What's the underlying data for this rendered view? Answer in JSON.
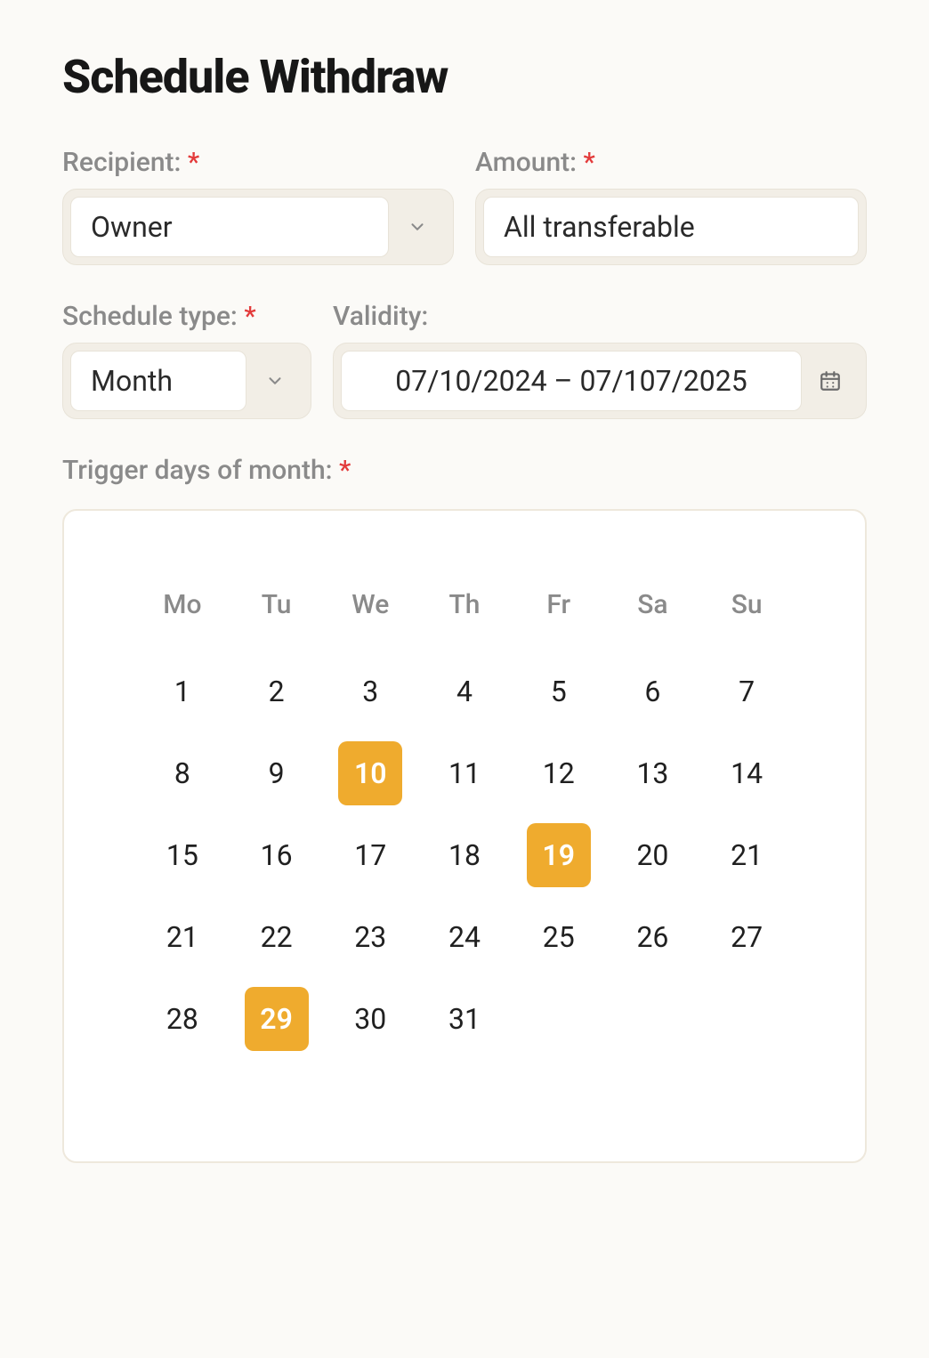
{
  "title": "Schedule Withdraw",
  "labels": {
    "recipient": "Recipient:",
    "amount": "Amount:",
    "schedule_type": "Schedule type:",
    "validity": "Validity:",
    "trigger_days": "Trigger days of month:"
  },
  "required_mark": "*",
  "fields": {
    "recipient": {
      "value": "Owner",
      "required": true
    },
    "amount": {
      "value": "All transferable",
      "required": true
    },
    "schedule_type": {
      "value": "Month",
      "required": true
    },
    "validity": {
      "value": "07/10/2024 – 07/107/2025",
      "required": false
    }
  },
  "calendar": {
    "weekdays": [
      "Mo",
      "Tu",
      "We",
      "Th",
      "Fr",
      "Sa",
      "Su"
    ],
    "days": [
      1,
      2,
      3,
      4,
      5,
      6,
      7,
      8,
      9,
      10,
      11,
      12,
      13,
      14,
      15,
      16,
      17,
      18,
      19,
      20,
      21,
      21,
      22,
      23,
      24,
      25,
      26,
      27,
      28,
      29,
      30,
      31
    ],
    "selected": [
      10,
      19,
      29
    ]
  },
  "colors": {
    "accent": "#efab2e",
    "label_muted": "#8a8a8a",
    "required": "#e33b3b",
    "panel_bg": "#f2eee6"
  }
}
